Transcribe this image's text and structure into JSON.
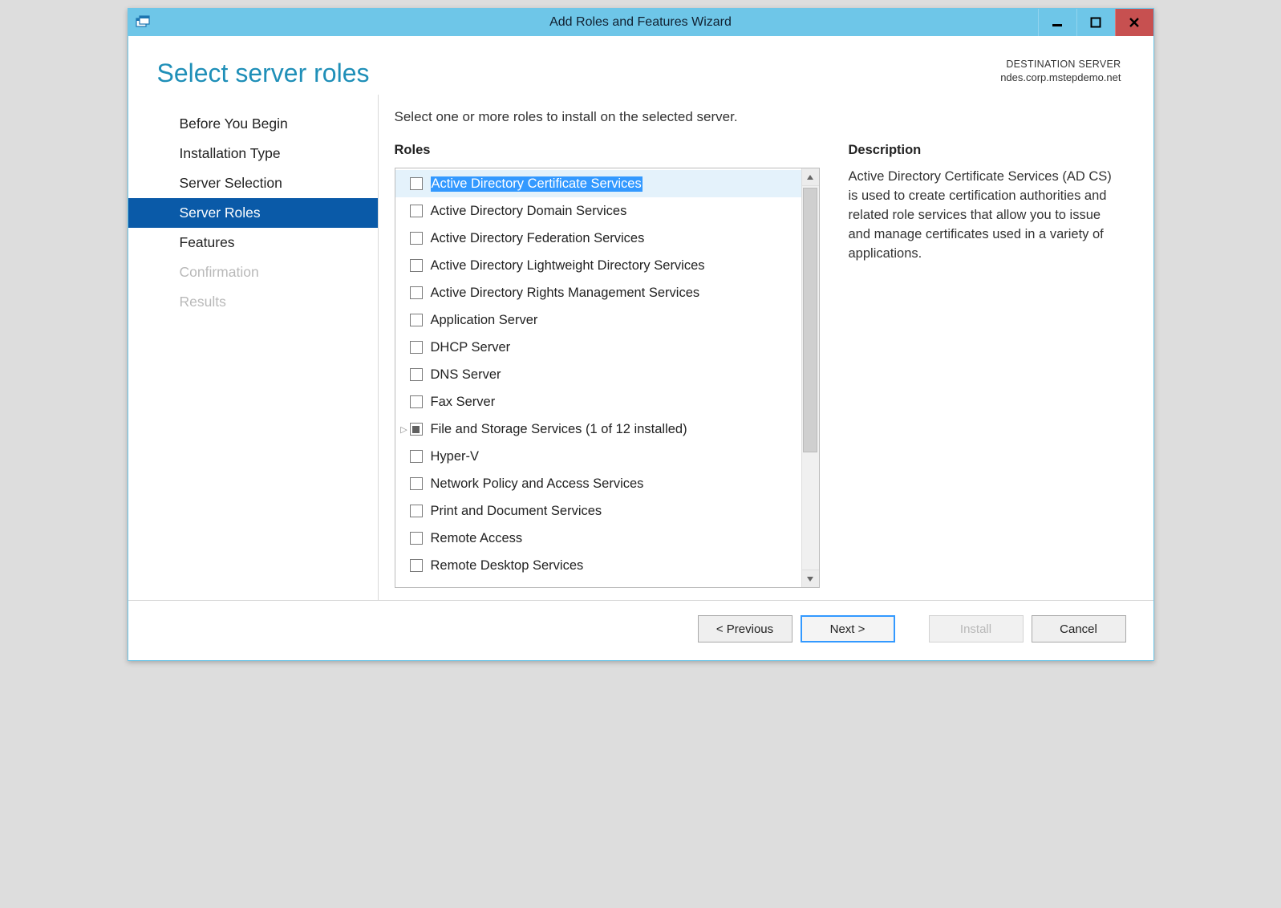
{
  "titlebar": {
    "title": "Add Roles and Features Wizard"
  },
  "header": {
    "page_title": "Select server roles",
    "dest_label": "DESTINATION SERVER",
    "dest_server": "ndes.corp.mstepdemo.net"
  },
  "nav": {
    "items": [
      {
        "label": "Before You Begin",
        "state": "normal"
      },
      {
        "label": "Installation Type",
        "state": "normal"
      },
      {
        "label": "Server Selection",
        "state": "normal"
      },
      {
        "label": "Server Roles",
        "state": "active"
      },
      {
        "label": "Features",
        "state": "normal"
      },
      {
        "label": "Confirmation",
        "state": "disabled"
      },
      {
        "label": "Results",
        "state": "disabled"
      }
    ]
  },
  "main": {
    "instruction": "Select one or more roles to install on the selected server.",
    "roles_heading": "Roles",
    "description_heading": "Description",
    "description_text": "Active Directory Certificate Services (AD CS) is used to create certification authorities and related role services that allow you to issue and manage certificates used in a variety of applications.",
    "roles": [
      {
        "label": "Active Directory Certificate Services",
        "checked": "none",
        "selected": true,
        "highlight": true
      },
      {
        "label": "Active Directory Domain Services",
        "checked": "none"
      },
      {
        "label": "Active Directory Federation Services",
        "checked": "none"
      },
      {
        "label": "Active Directory Lightweight Directory Services",
        "checked": "none"
      },
      {
        "label": "Active Directory Rights Management Services",
        "checked": "none"
      },
      {
        "label": "Application Server",
        "checked": "none"
      },
      {
        "label": "DHCP Server",
        "checked": "none"
      },
      {
        "label": "DNS Server",
        "checked": "none"
      },
      {
        "label": "Fax Server",
        "checked": "none"
      },
      {
        "label": "File and Storage Services (1 of 12 installed)",
        "checked": "partial",
        "expandable": true
      },
      {
        "label": "Hyper-V",
        "checked": "none"
      },
      {
        "label": "Network Policy and Access Services",
        "checked": "none"
      },
      {
        "label": "Print and Document Services",
        "checked": "none"
      },
      {
        "label": "Remote Access",
        "checked": "none"
      },
      {
        "label": "Remote Desktop Services",
        "checked": "none"
      }
    ]
  },
  "footer": {
    "previous": "< Previous",
    "next": "Next >",
    "install": "Install",
    "cancel": "Cancel"
  }
}
